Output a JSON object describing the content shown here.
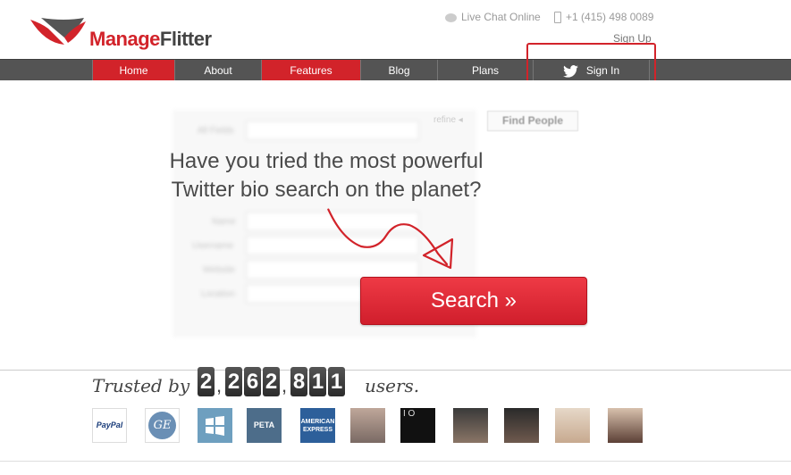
{
  "brand": {
    "name_part1": "Manage",
    "name_part2": "Flitter",
    "accent": "#d2232a"
  },
  "topbar": {
    "live_chat": "Live Chat Online",
    "phone": "+1 (415) 498 0089",
    "signup": "Sign Up"
  },
  "nav": {
    "items": [
      {
        "label": "Home"
      },
      {
        "label": "About"
      },
      {
        "label": "Features"
      },
      {
        "label": "Blog"
      },
      {
        "label": "Plans"
      },
      {
        "label": "Sign In"
      }
    ]
  },
  "search_form": {
    "all_fields_label": "All Fields",
    "refine_label": "refine",
    "find_button": "Find People",
    "fields": [
      "Name",
      "Username",
      "Website",
      "Location"
    ]
  },
  "hero": {
    "headline_line1": "Have you tried the most powerful",
    "headline_line2": "Twitter bio search on the planet?",
    "search_button": "Search »"
  },
  "trusted": {
    "prefix": "Trusted by",
    "suffix": "users.",
    "digits": [
      "2",
      "2",
      "6",
      "2",
      "8",
      "1",
      "1"
    ],
    "separators": [
      ",",
      ","
    ]
  },
  "logos": {
    "paypal": "PayPal",
    "ge": "GE",
    "windows": "",
    "peta": "PETA",
    "amex_line1": "AMERICAN",
    "amex_line2": "EXPRESS",
    "io": "I O"
  }
}
